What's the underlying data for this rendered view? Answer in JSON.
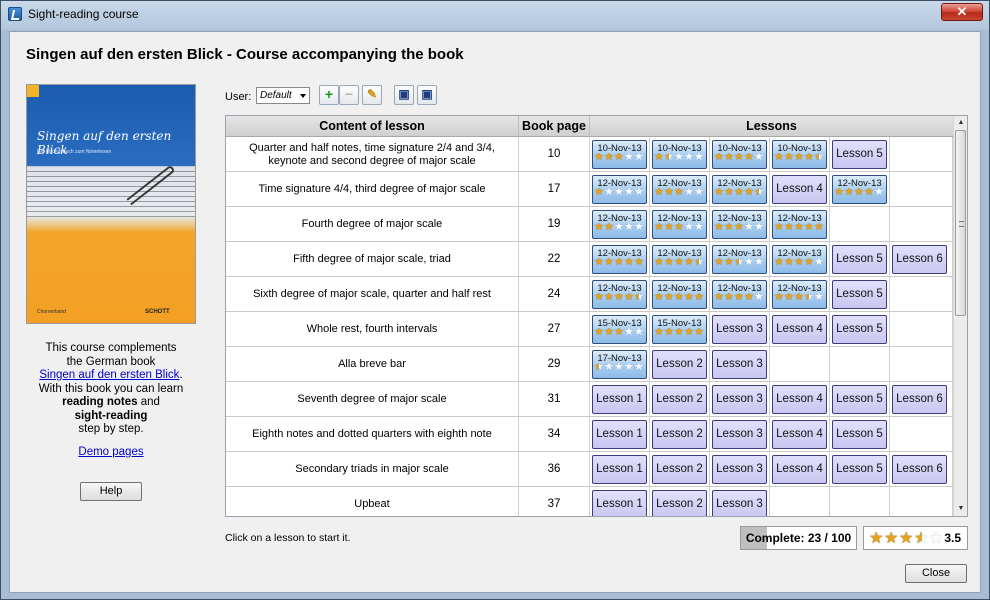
{
  "window": {
    "title": "Sight-reading course",
    "close_glyph": "✕"
  },
  "course_title": "Singen auf den ersten Blick - Course accompanying the book",
  "book_cover": {
    "title": "Singen auf den ersten Blick",
    "subtitle": "Ein Übungsbuch zum Notenlesen",
    "publisher": "SCHOTT",
    "left_logo": "Chorverband"
  },
  "description": {
    "line1": "This course complements",
    "line2": "the German book",
    "book_link": "Singen auf den ersten Blick",
    "period": ".",
    "line3": "With this book you can learn",
    "bold1": "reading notes",
    "and": " and",
    "bold2": "sight-reading",
    "line4": "step by step."
  },
  "demo_link": "Demo pages",
  "help_button": "Help",
  "toolbar": {
    "user_label": "User:",
    "user_value": "Default",
    "add_glyph": "+",
    "remove_glyph": "−",
    "edit_glyph": "✎",
    "save_glyph": "▣",
    "load_glyph": "▣",
    "icons": [
      "add-user-icon",
      "remove-user-icon",
      "edit-user-icon",
      "save-icon",
      "load-icon"
    ]
  },
  "table": {
    "headers": {
      "content": "Content of lesson",
      "page": "Book page",
      "lessons": "Lessons"
    },
    "rows": [
      {
        "content": "Quarter and half notes, time signature 2/4 and 3/4, keynote and second degree of major scale",
        "page": "10",
        "lessons": [
          {
            "date": "10-Nov-13",
            "stars": 3
          },
          {
            "date": "10-Nov-13",
            "stars": 1.5
          },
          {
            "date": "10-Nov-13",
            "stars": 4
          },
          {
            "date": "10-Nov-13",
            "stars": 4.5
          },
          {
            "label": "Lesson 5"
          }
        ]
      },
      {
        "content": "Time signature 4/4, third degree of major scale",
        "page": "17",
        "lessons": [
          {
            "date": "12-Nov-13",
            "stars": 1
          },
          {
            "date": "12-Nov-13",
            "stars": 3
          },
          {
            "date": "12-Nov-13",
            "stars": 4.5
          },
          {
            "label": "Lesson 4"
          },
          {
            "date": "12-Nov-13",
            "stars": 4
          }
        ]
      },
      {
        "content": "Fourth degree of major scale",
        "page": "19",
        "lessons": [
          {
            "date": "12-Nov-13",
            "stars": 2
          },
          {
            "date": "12-Nov-13",
            "stars": 3
          },
          {
            "date": "12-Nov-13",
            "stars": 3
          },
          {
            "date": "12-Nov-13",
            "stars": 5
          }
        ]
      },
      {
        "content": "Fifth degree of major scale, triad",
        "page": "22",
        "lessons": [
          {
            "date": "12-Nov-13",
            "stars": 5
          },
          {
            "date": "12-Nov-13",
            "stars": 4.5
          },
          {
            "date": "12-Nov-13",
            "stars": 2.5
          },
          {
            "date": "12-Nov-13",
            "stars": 4
          },
          {
            "label": "Lesson 5"
          },
          {
            "label": "Lesson 6"
          }
        ]
      },
      {
        "content": "Sixth degree of major scale, quarter and half rest",
        "page": "24",
        "lessons": [
          {
            "date": "12-Nov-13",
            "stars": 4.5
          },
          {
            "date": "12-Nov-13",
            "stars": 5
          },
          {
            "date": "12-Nov-13",
            "stars": 4
          },
          {
            "date": "12-Nov-13",
            "stars": 3.5
          },
          {
            "label": "Lesson 5"
          }
        ]
      },
      {
        "content": "Whole rest, fourth intervals",
        "page": "27",
        "lessons": [
          {
            "date": "15-Nov-13",
            "stars": 3
          },
          {
            "date": "15-Nov-13",
            "stars": 5
          },
          {
            "label": "Lesson 3"
          },
          {
            "label": "Lesson 4"
          },
          {
            "label": "Lesson 5"
          }
        ]
      },
      {
        "content": "Alla breve bar",
        "page": "29",
        "lessons": [
          {
            "date": "17-Nov-13",
            "stars": 0.5
          },
          {
            "label": "Lesson 2"
          },
          {
            "label": "Lesson 3"
          }
        ]
      },
      {
        "content": "Seventh degree of major scale",
        "page": "31",
        "lessons": [
          {
            "label": "Lesson 1"
          },
          {
            "label": "Lesson 2"
          },
          {
            "label": "Lesson 3"
          },
          {
            "label": "Lesson 4"
          },
          {
            "label": "Lesson 5"
          },
          {
            "label": "Lesson 6"
          }
        ]
      },
      {
        "content": "Eighth notes and dotted quarters with eighth note",
        "page": "34",
        "lessons": [
          {
            "label": "Lesson 1"
          },
          {
            "label": "Lesson 2"
          },
          {
            "label": "Lesson 3"
          },
          {
            "label": "Lesson 4"
          },
          {
            "label": "Lesson 5"
          }
        ]
      },
      {
        "content": "Secondary triads in major scale",
        "page": "36",
        "lessons": [
          {
            "label": "Lesson 1"
          },
          {
            "label": "Lesson 2"
          },
          {
            "label": "Lesson 3"
          },
          {
            "label": "Lesson 4"
          },
          {
            "label": "Lesson 5"
          },
          {
            "label": "Lesson 6"
          }
        ]
      },
      {
        "content": "Upbeat",
        "page": "37",
        "lessons": [
          {
            "label": "Lesson 1"
          },
          {
            "label": "Lesson 2"
          },
          {
            "label": "Lesson 3"
          }
        ]
      }
    ]
  },
  "footer": {
    "hint": "Click on a lesson to start it.",
    "complete_label": "Complete: 23 / 100",
    "complete_fraction": 0.23,
    "rating_stars": 3.5,
    "rating_value": "3.5",
    "close_button": "Close"
  },
  "colors": {
    "lesson_open": "#c9c6f1",
    "lesson_done": "#a8cdf0",
    "star": "#e7a21b"
  }
}
